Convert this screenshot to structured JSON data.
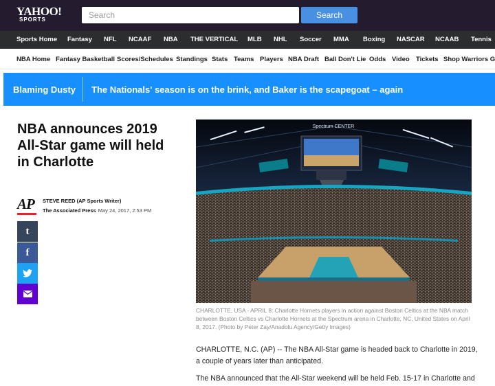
{
  "header": {
    "logo_line1": "YAHOO!",
    "logo_line2": "SPORTS",
    "search_placeholder": "Search",
    "search_button": "Search"
  },
  "sports_nav": [
    {
      "label": "Sports Home"
    },
    {
      "label": "Fantasy"
    },
    {
      "label": "NFL"
    },
    {
      "label": "NCAAF"
    },
    {
      "label": "NBA"
    },
    {
      "label": "THE VERTICAL"
    },
    {
      "label": "MLB"
    },
    {
      "label": "NHL"
    },
    {
      "label": "Soccer"
    },
    {
      "label": "MMA"
    },
    {
      "label": "Boxing"
    },
    {
      "label": "NASCAR"
    },
    {
      "label": "NCAAB"
    },
    {
      "label": "Tennis"
    }
  ],
  "nba_nav": [
    {
      "label": "NBA Home"
    },
    {
      "label": "Fantasy Basketball"
    },
    {
      "label": "Scores/Schedules"
    },
    {
      "label": "Standings"
    },
    {
      "label": "Stats"
    },
    {
      "label": "Teams"
    },
    {
      "label": "Players"
    },
    {
      "label": "NBA Draft"
    },
    {
      "label": "Ball Don't Lie"
    },
    {
      "label": "Odds"
    },
    {
      "label": "Video"
    },
    {
      "label": "Tickets"
    },
    {
      "label": "Shop Warriors Gear"
    }
  ],
  "banner": {
    "blog": "Blaming Dusty",
    "story": "The Nationals' season is on the brink, and Baker is the scapegoat – again"
  },
  "article": {
    "headline": "NBA announces 2019 All-Star game will held in Charlotte",
    "source_logo": "AP",
    "author": "STEVE REED (AP Sports Writer)",
    "source": "The Associated Press",
    "timestamp": "May 24, 2017, 2:53 PM",
    "photo": {
      "arena_sign": "Spectrum CENTER"
    },
    "caption": "CHARLOTTE, USA - APRIL 8: Charlotte Hornets players in action against Boston Celtics at the NBA match between Boston Celtics vs Charlotte Hornets at the Spectrum arena in Charlotte, NC, United States on April 8, 2017. (Photo by Peter Zay/Anadolu Agency/Getty Images)",
    "paragraphs": [
      "CHARLOTTE, N.C. (AP) -- The NBA All-Star game is headed back to Charlotte in 2019, a couple of years later than anticipated.",
      "The NBA announced that the All-Star weekend will be held Feb. 15-17 in Charlotte and"
    ]
  },
  "share_buttons": [
    {
      "icon": "tumblr-icon",
      "glyph": "t"
    },
    {
      "icon": "facebook-icon",
      "glyph": "f"
    },
    {
      "icon": "twitter-icon"
    },
    {
      "icon": "mail-icon"
    }
  ],
  "colors": {
    "header_bg": "#241b2f",
    "sports_nav_bg": "#2c2d2f",
    "search_button": "#4a90e2",
    "banner": "#188fff",
    "tumblr": "#35465c",
    "facebook": "#3b5998",
    "twitter": "#1da1f2",
    "mail": "#6001d2",
    "ap_red": "#e8202a"
  }
}
